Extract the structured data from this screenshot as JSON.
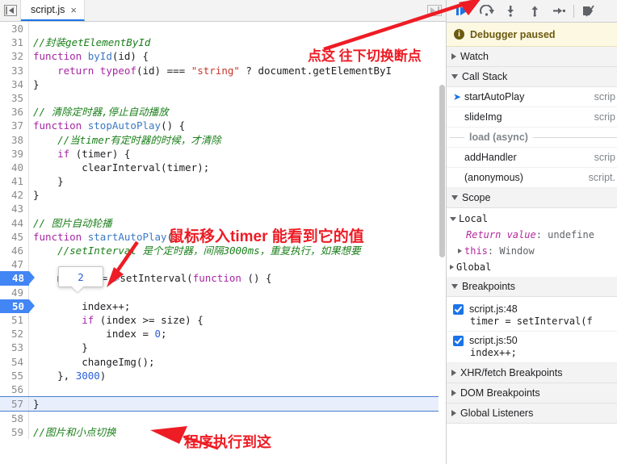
{
  "window": {
    "title": "Chrome DevTools — Sources panel (paused on breakpoint)"
  },
  "tabbar": {
    "toggle_icon": "panel-collapse-icon",
    "tabs": [
      {
        "label": "script.js",
        "close_label": "×",
        "active": true
      }
    ],
    "right_toggle_icon": "panel-expand-icon"
  },
  "editor": {
    "first_line": 30,
    "lines": [
      {
        "n": 30,
        "tokens": []
      },
      {
        "n": 31,
        "tokens": [
          {
            "c": "t-com",
            "t": "//封装getElementById"
          }
        ]
      },
      {
        "n": 32,
        "tokens": [
          {
            "c": "t-kw",
            "t": "function"
          },
          {
            "c": "t-plain",
            "t": " "
          },
          {
            "c": "t-fn",
            "t": "byId"
          },
          {
            "c": "t-plain",
            "t": "(id) {"
          }
        ]
      },
      {
        "n": 33,
        "tokens": [
          {
            "c": "t-plain",
            "t": "    "
          },
          {
            "c": "t-kw",
            "t": "return"
          },
          {
            "c": "t-plain",
            "t": " "
          },
          {
            "c": "t-kw",
            "t": "typeof"
          },
          {
            "c": "t-plain",
            "t": "(id) === "
          },
          {
            "c": "t-str",
            "t": "\"string\""
          },
          {
            "c": "t-plain",
            "t": " ? document.getElementByI"
          }
        ]
      },
      {
        "n": 34,
        "tokens": [
          {
            "c": "t-plain",
            "t": "}"
          }
        ]
      },
      {
        "n": 35,
        "tokens": []
      },
      {
        "n": 36,
        "tokens": [
          {
            "c": "t-com",
            "t": "// 清除定时器,停止自动播放"
          }
        ]
      },
      {
        "n": 37,
        "tokens": [
          {
            "c": "t-kw",
            "t": "function"
          },
          {
            "c": "t-plain",
            "t": " "
          },
          {
            "c": "t-fn",
            "t": "stopAutoPlay"
          },
          {
            "c": "t-plain",
            "t": "() {"
          }
        ]
      },
      {
        "n": 38,
        "tokens": [
          {
            "c": "t-plain",
            "t": "    "
          },
          {
            "c": "t-com",
            "t": "//当timer有定时器的时候，才清除"
          }
        ]
      },
      {
        "n": 39,
        "tokens": [
          {
            "c": "t-plain",
            "t": "    "
          },
          {
            "c": "t-kw",
            "t": "if"
          },
          {
            "c": "t-plain",
            "t": " (timer) {"
          }
        ]
      },
      {
        "n": 40,
        "tokens": [
          {
            "c": "t-plain",
            "t": "        clearInterval(timer);"
          }
        ]
      },
      {
        "n": 41,
        "tokens": [
          {
            "c": "t-plain",
            "t": "    }"
          }
        ]
      },
      {
        "n": 42,
        "tokens": [
          {
            "c": "t-plain",
            "t": "}"
          }
        ]
      },
      {
        "n": 43,
        "tokens": []
      },
      {
        "n": 44,
        "tokens": [
          {
            "c": "t-com",
            "t": "// 图片自动轮播"
          }
        ]
      },
      {
        "n": 45,
        "tokens": [
          {
            "c": "t-kw",
            "t": "function"
          },
          {
            "c": "t-plain",
            "t": " "
          },
          {
            "c": "t-fn",
            "t": "startAutoPlay"
          },
          {
            "c": "t-plain",
            "t": "() {"
          }
        ]
      },
      {
        "n": 46,
        "tokens": [
          {
            "c": "t-plain",
            "t": "    "
          },
          {
            "c": "t-com",
            "t": "//setInterval 是个定时器，间隔3000ms，重复执行，如果想要"
          }
        ]
      },
      {
        "n": 47,
        "tokens": []
      },
      {
        "n": 48,
        "breakpoint": true,
        "tokens": [
          {
            "c": "t-plain",
            "t": "    "
          },
          {
            "c": "fold",
            "t": "▶"
          },
          {
            "c": "tok-hl",
            "t": "timer"
          },
          {
            "c": "t-plain",
            "t": " = "
          },
          {
            "c": "fold",
            "t": "▷"
          },
          {
            "c": "t-plain",
            "t": "setInterval("
          },
          {
            "c": "t-kw",
            "t": "function"
          },
          {
            "c": "t-plain",
            "t": " () {"
          }
        ]
      },
      {
        "n": 49,
        "tokens": []
      },
      {
        "n": 50,
        "breakpoint": true,
        "tokens": [
          {
            "c": "t-plain",
            "t": "        index++;"
          }
        ]
      },
      {
        "n": 51,
        "tokens": [
          {
            "c": "t-plain",
            "t": "        "
          },
          {
            "c": "t-kw",
            "t": "if"
          },
          {
            "c": "t-plain",
            "t": " (index >= size) {"
          }
        ]
      },
      {
        "n": 52,
        "tokens": [
          {
            "c": "t-plain",
            "t": "            index = "
          },
          {
            "c": "t-num",
            "t": "0"
          },
          {
            "c": "t-plain",
            "t": ";"
          }
        ]
      },
      {
        "n": 53,
        "tokens": [
          {
            "c": "t-plain",
            "t": "        }"
          }
        ]
      },
      {
        "n": 54,
        "tokens": [
          {
            "c": "t-plain",
            "t": "        changeImg();"
          }
        ]
      },
      {
        "n": 55,
        "tokens": [
          {
            "c": "t-plain",
            "t": "    }, "
          },
          {
            "c": "t-num",
            "t": "3000"
          },
          {
            "c": "t-plain",
            "t": ")"
          }
        ]
      },
      {
        "n": 56,
        "tokens": []
      },
      {
        "n": 57,
        "execpoint": true,
        "tokens": [
          {
            "c": "t-plain",
            "t": "}"
          }
        ]
      },
      {
        "n": 58,
        "tokens": []
      },
      {
        "n": 59,
        "tokens": [
          {
            "c": "t-com",
            "t": "//图片和小点切换"
          }
        ]
      }
    ],
    "value_tooltip": "2"
  },
  "debug_toolbar": {
    "buttons": [
      {
        "name": "resume-script-execution",
        "icon": "resume-icon"
      },
      {
        "name": "step-over-next-function-call",
        "icon": "step-over-icon"
      },
      {
        "name": "step-into-next-function-call",
        "icon": "step-into-icon"
      },
      {
        "name": "step-out-of-current-function",
        "icon": "step-out-icon"
      },
      {
        "name": "step",
        "icon": "step-icon"
      },
      {
        "name": "deactivate-breakpoints",
        "icon": "deactivate-breakpoints-icon"
      }
    ]
  },
  "sidebar": {
    "paused_banner": {
      "icon": "info-icon",
      "text": "Debugger paused"
    },
    "sections": {
      "watch": {
        "label": "Watch",
        "expanded": false
      },
      "call_stack": {
        "label": "Call Stack",
        "expanded": true,
        "frames": [
          {
            "name": "startAutoPlay",
            "location": "scrip",
            "current": true
          },
          {
            "name": "slideImg",
            "location": "scrip",
            "current": false
          },
          {
            "name": "load (async)",
            "async": true
          },
          {
            "name": "addHandler",
            "location": "scrip",
            "current": false
          },
          {
            "name": "(anonymous)",
            "location": "script.",
            "current": false
          }
        ]
      },
      "scope": {
        "label": "Scope",
        "expanded": true,
        "entries": [
          {
            "kind": "group",
            "label": "Local",
            "expanded": true
          },
          {
            "kind": "return",
            "label": "Return value",
            "value": "undefine"
          },
          {
            "kind": "this",
            "label": "this",
            "value": "Window",
            "expanded": false
          },
          {
            "kind": "group",
            "label": "Global",
            "expanded": false
          }
        ]
      },
      "breakpoints": {
        "label": "Breakpoints",
        "expanded": true,
        "items": [
          {
            "checked": true,
            "file": "script.js:48",
            "code": "timer = setInterval(f"
          },
          {
            "checked": true,
            "file": "script.js:50",
            "code": "index++;"
          }
        ]
      },
      "xhr_breakpoints": {
        "label": "XHR/fetch Breakpoints",
        "expanded": false
      },
      "dom_breakpoints": {
        "label": "DOM Breakpoints",
        "expanded": false
      },
      "global_listeners": {
        "label": "Global Listeners",
        "expanded": false
      }
    }
  },
  "annotations": {
    "color": "#ee1c25",
    "items": [
      {
        "id": "anno-top",
        "text": "点这 往下切换断点"
      },
      {
        "id": "anno-mid",
        "text": "鼠标移入timer  能看到它的值"
      },
      {
        "id": "anno-bot",
        "text": "程序执行到这"
      }
    ]
  }
}
